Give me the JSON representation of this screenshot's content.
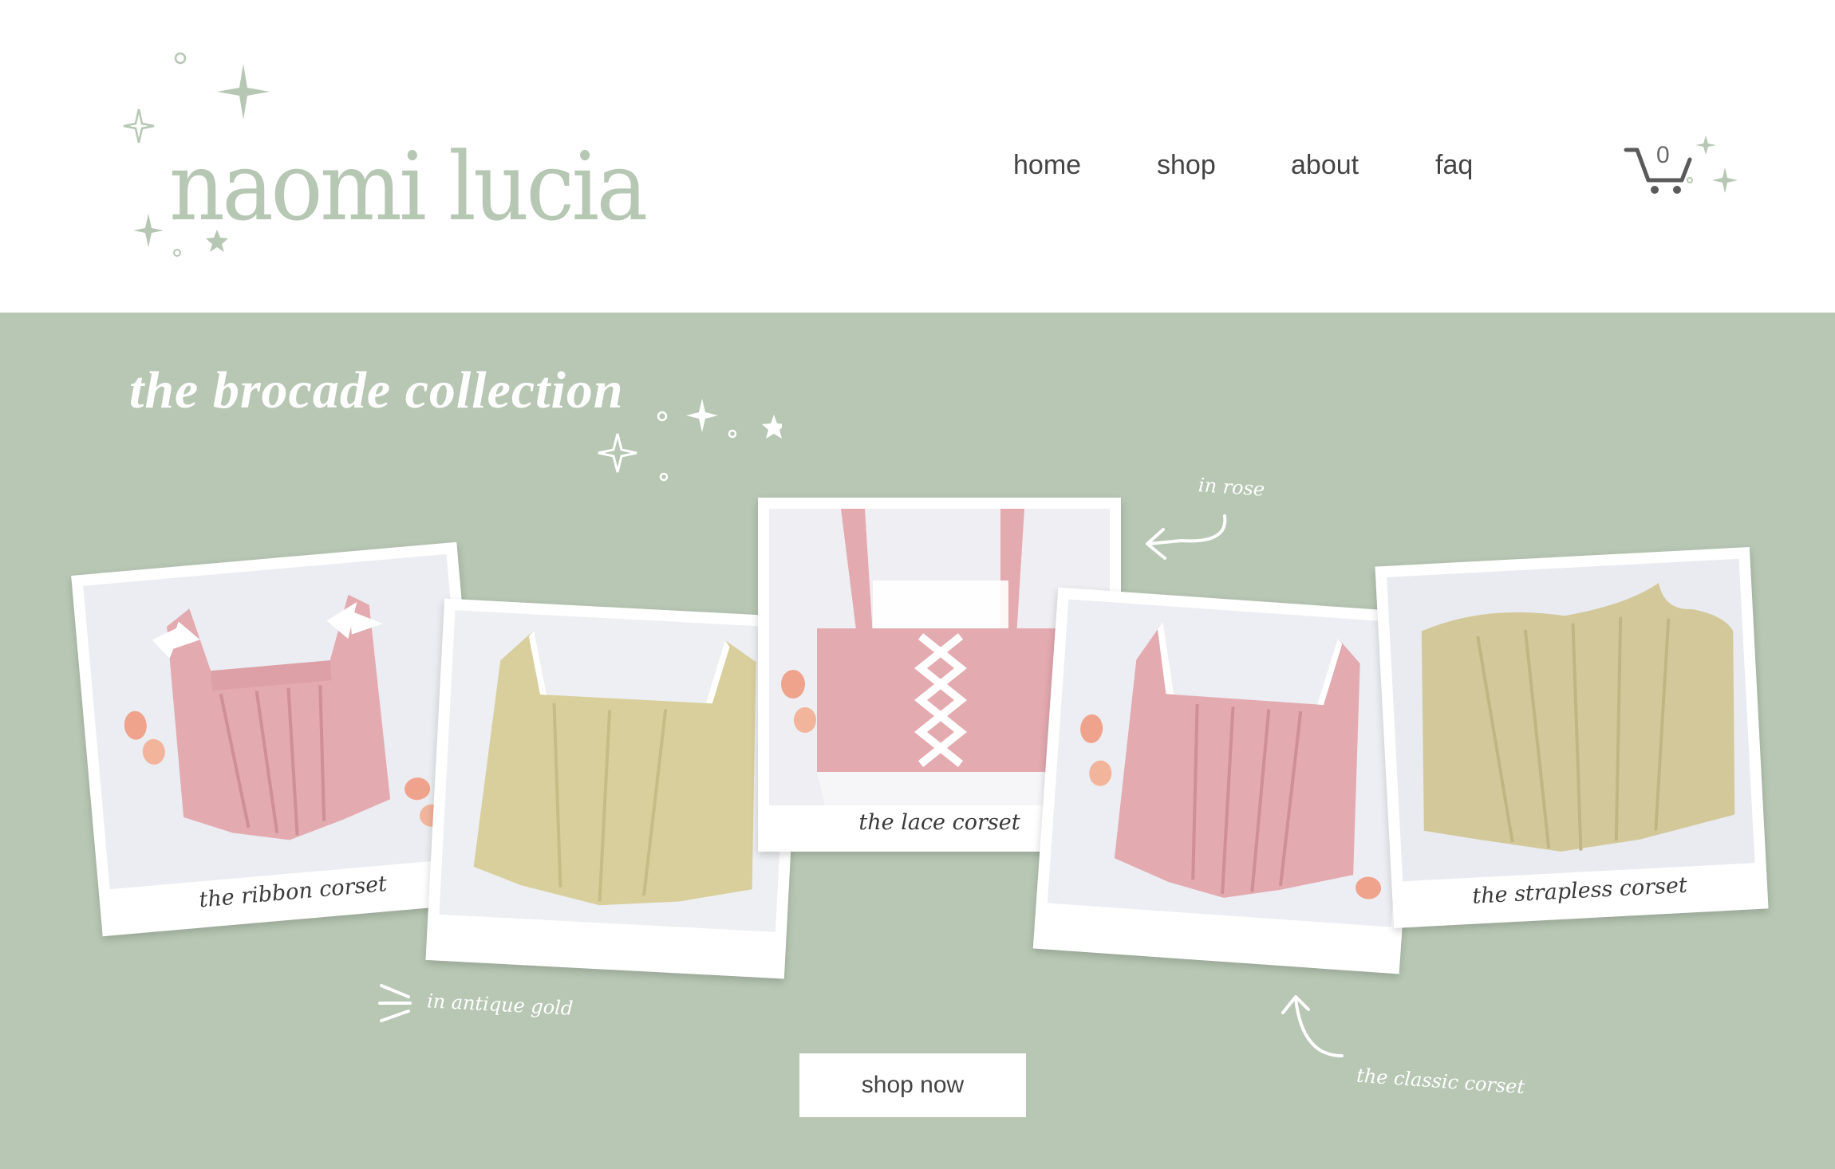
{
  "brand": {
    "name": "naomi lucia",
    "accent_color": "#b6c7b3"
  },
  "nav": {
    "items": [
      "home",
      "shop",
      "about",
      "faq"
    ]
  },
  "cart": {
    "count": "0",
    "icon": "cart-icon"
  },
  "hero": {
    "background_color": "#b7c7b3",
    "title": "the brocade collection",
    "cta_label": "shop now"
  },
  "products": [
    {
      "caption": "the ribbon corset",
      "color": "rose"
    },
    {
      "caption": "",
      "color": "antique gold"
    },
    {
      "caption": "the lace corset",
      "color": "rose"
    },
    {
      "caption": "",
      "color": "rose"
    },
    {
      "caption": "the strapless corset",
      "color": "antique gold"
    }
  ],
  "annotations": {
    "in_rose": "in rose",
    "in_antique_gold": "in antique gold",
    "classic": "the classic corset"
  }
}
